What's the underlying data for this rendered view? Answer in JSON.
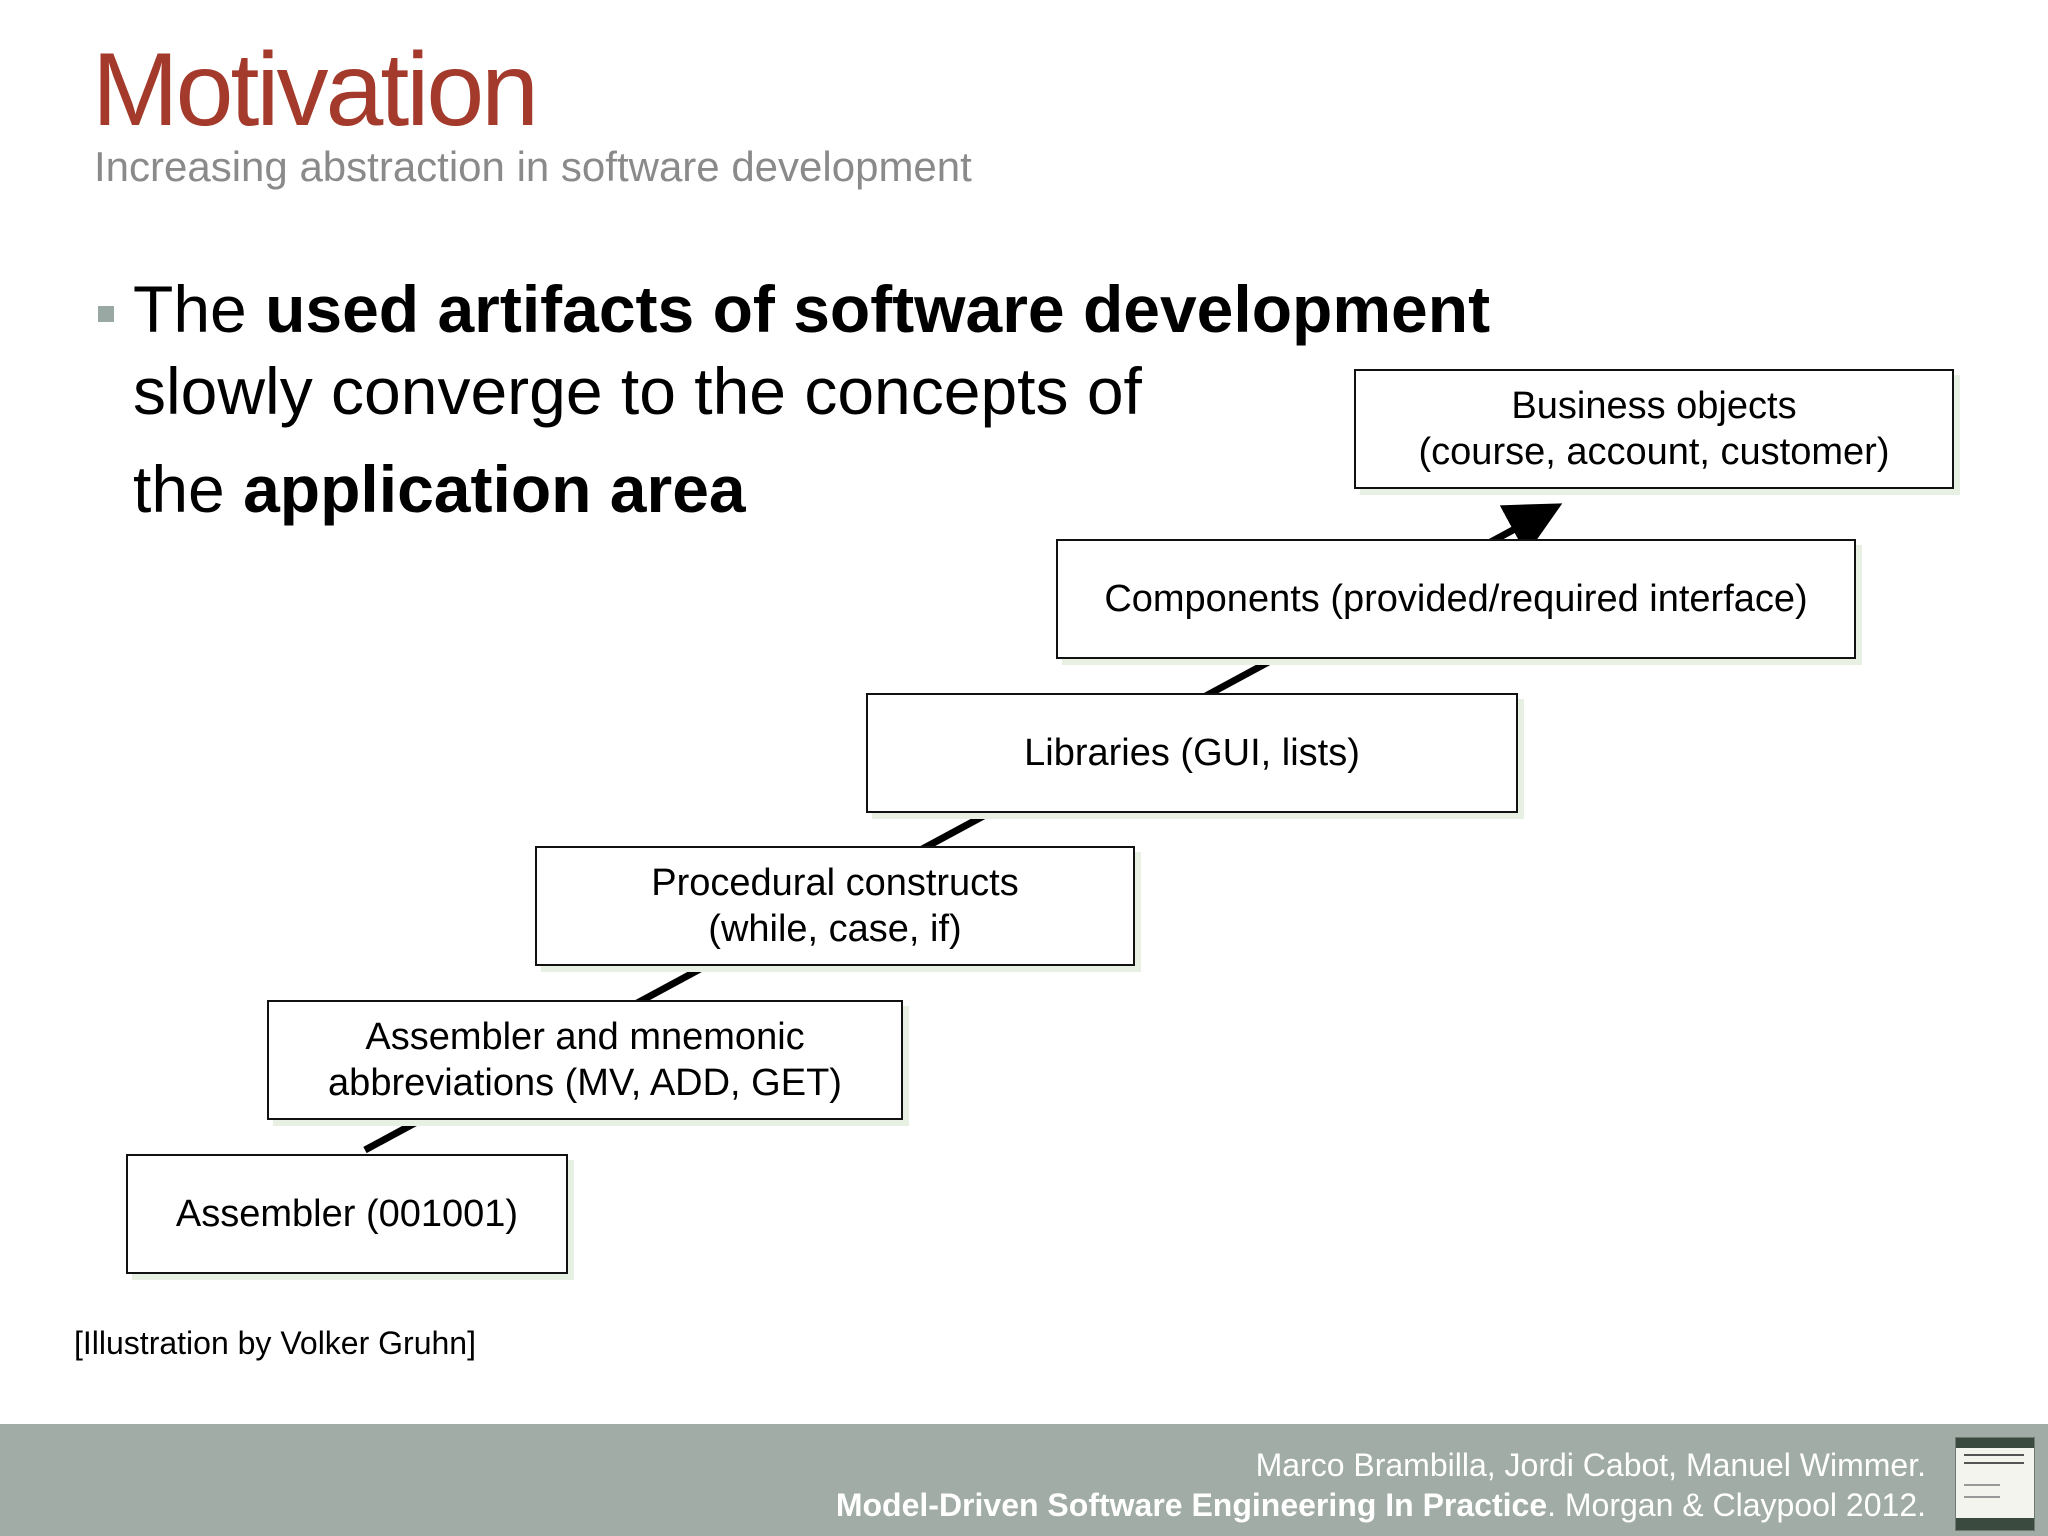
{
  "slide": {
    "title": "Motivation",
    "subtitle": "Increasing abstraction in software development"
  },
  "bullet": {
    "part1": "The ",
    "part1_bold": "used artifacts of software development",
    "part2": "slowly converge to the concepts of",
    "part3": "the ",
    "part3_bold": "application area"
  },
  "diagram": {
    "levels": [
      {
        "line1": "Assembler (001001)",
        "line2": ""
      },
      {
        "line1": "Assembler and mnemonic",
        "line2": "abbreviations (MV, ADD, GET)"
      },
      {
        "line1": "Procedural constructs",
        "line2": "(while, case, if)"
      },
      {
        "line1": "Libraries (GUI, lists)",
        "line2": ""
      },
      {
        "line1": "Components (provided/required interface)",
        "line2": ""
      },
      {
        "line1": "Business objects",
        "line2": "(course, account, customer)"
      }
    ],
    "credit": "[Illustration by Volker Gruhn]"
  },
  "footer": {
    "authors": "Marco Brambilla, Jordi Cabot, Manuel Wimmer.",
    "book_title": "Model-Driven Software Engineering In Practice",
    "publisher": ". Morgan & Claypool 2012.",
    "colors": {
      "band": "#a0aca5",
      "text": "#ffffff"
    }
  },
  "colors": {
    "title": "#a33a2b",
    "subtitle": "#8a8a8a",
    "bullet": "#9aa8a4"
  }
}
